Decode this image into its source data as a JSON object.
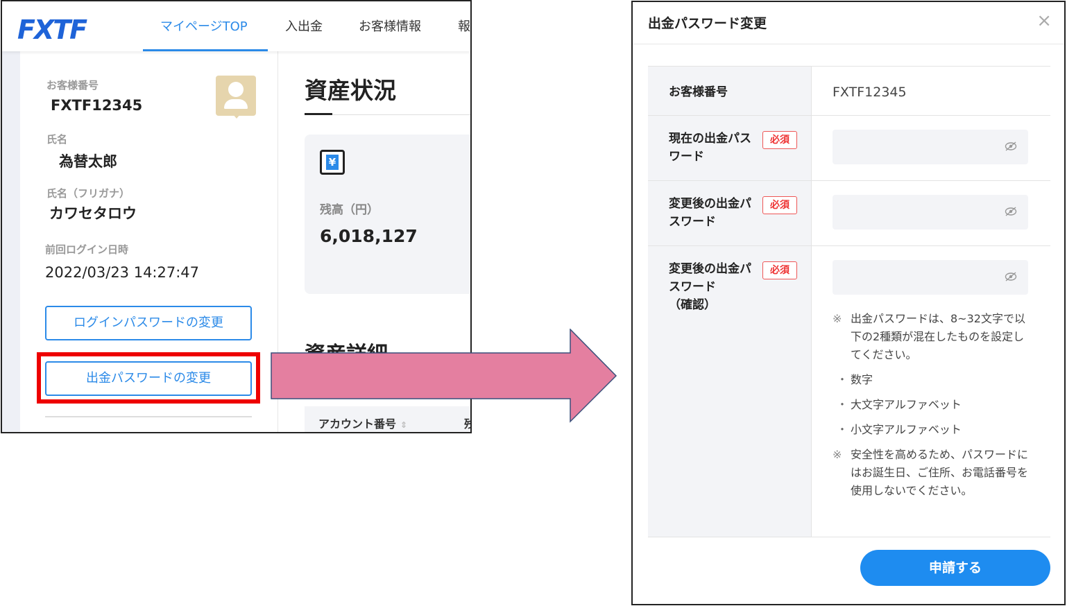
{
  "left_screen": {
    "logo": "FXTF",
    "nav_tabs": [
      {
        "label": "マイページTOP"
      },
      {
        "label": "入出金"
      },
      {
        "label": "お客様情報"
      },
      {
        "label": "報"
      }
    ],
    "profile": {
      "customer_number_label": "お客様番号",
      "customer_number": "FXTF12345",
      "name_label": "氏名",
      "name": "為替太郎",
      "kana_label": "氏名（フリガナ）",
      "kana": "カワセタロウ",
      "last_login_label": "前回ログイン日時",
      "last_login": "2022/03/23 14:27:47",
      "login_pw_button": "ログインパスワードの変更",
      "withdraw_pw_button": "出金パスワードの変更"
    },
    "main": {
      "title": "資産状況",
      "yen_symbol": "¥",
      "balance_label": "残高（円）",
      "balance_value": "6,018,127",
      "detail_title": "資産詳細",
      "table_header_account": "アカウント番号",
      "table_header_sort": "⇕",
      "table_header_cut": "残"
    }
  },
  "colors": {
    "accent_blue": "#2b8ae8",
    "highlight_red": "#ee0000",
    "arrow_pink": "#e47fa0",
    "required_red": "#e33333"
  },
  "modal": {
    "title": "出金パスワード変更",
    "close_icon": "×",
    "required_badge": "必須",
    "fields": {
      "customer_number_label": "お客様番号",
      "customer_number_value": "FXTF12345",
      "current_pw_label": "現在の出金パスワード",
      "new_pw_label": "変更後の出金パスワード",
      "confirm_pw_label_1": "変更後の出金パスワード",
      "confirm_pw_label_2": "（確認）"
    },
    "notes": {
      "mark": "※",
      "rule": "出金パスワードは、8~32文字で以下の2種類が混在したものを設定してください。",
      "bullets": [
        "数字",
        "大文字アルファベット",
        "小文字アルファベット"
      ],
      "bullet_mark": "・",
      "security": "安全性を高めるため、パスワードにはお誕生日、ご住所、お電話番号を使用しないでください。"
    },
    "submit_label": "申請する"
  }
}
